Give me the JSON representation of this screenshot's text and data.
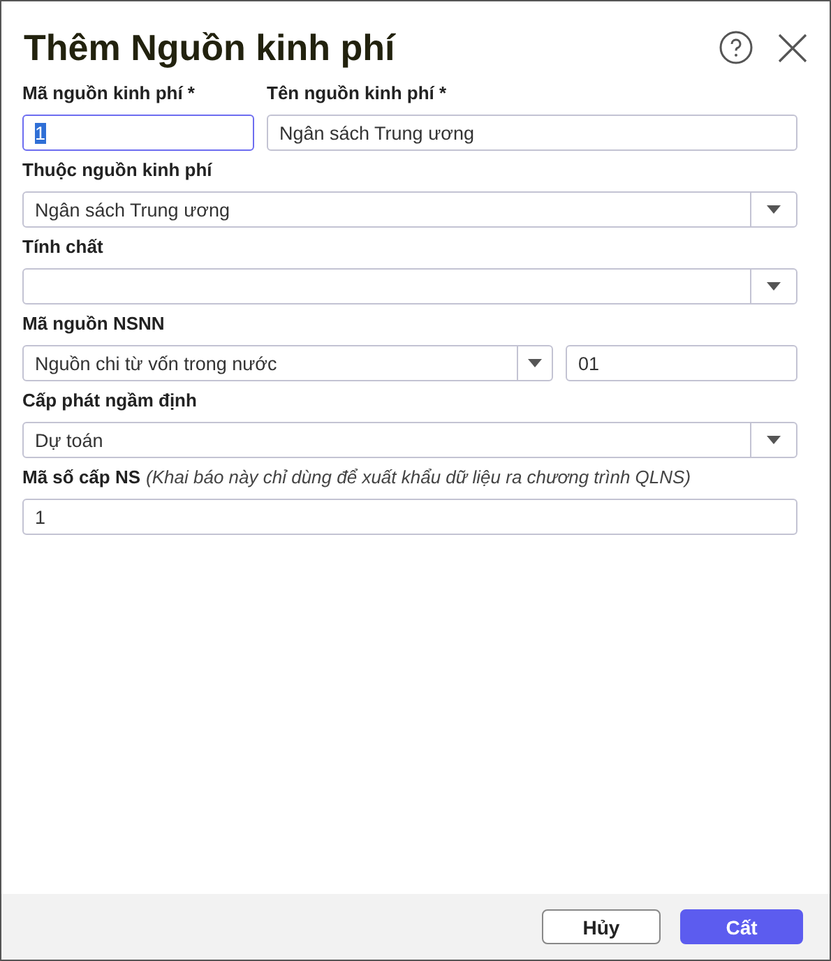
{
  "dialog": {
    "title": "Thêm Nguồn kinh phí"
  },
  "fields": [
    {
      "kind": "text",
      "label": "Mã nguồn kinh phí *",
      "value": "1",
      "focused": true,
      "text_selected": true
    },
    {
      "kind": "text",
      "label": "Tên nguồn kinh phí *",
      "value": "Ngân sách Trung ương",
      "focused": false,
      "text_selected": false
    },
    {
      "kind": "select",
      "label": "Thuộc nguồn kinh phí",
      "value": "Ngân sách Trung ương"
    },
    {
      "kind": "select",
      "label": "Tính chất"
    },
    {
      "kind": "select_code",
      "label": "Mã nguồn NSNN",
      "value": "Nguồn chi từ vốn trong nước",
      "code": "01"
    },
    {
      "kind": "select",
      "label": "Cấp phát ngầm định",
      "value": "Dự toán"
    },
    {
      "kind": "text",
      "label": "Mã số cấp NS",
      "note": "(Khai báo này chỉ dùng để xuất khẩu dữ liệu ra chương trình QLNS)",
      "value": "1",
      "focused": false,
      "text_selected": false
    }
  ],
  "buttons": [
    {
      "label": "Hủy",
      "kind": "secondary"
    },
    {
      "label": "Cất",
      "kind": "primary"
    }
  ]
}
